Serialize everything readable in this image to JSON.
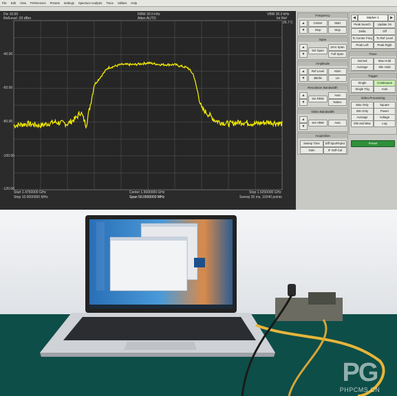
{
  "menu": [
    "File",
    "Edit",
    "View",
    "Preferences",
    "Presets",
    "Settings",
    "Spectrum Analysis",
    "Trace",
    "Utilities",
    "Help"
  ],
  "screen": {
    "div": "Div 10.00",
    "ref_level": "RefLevel -20 dBm",
    "rbw": "RBW 30.0 kHz",
    "atten": "Atten AUTO",
    "vbw": "VBW 30.0 kHz",
    "int_ref": "Int Ref",
    "temp": "25.7 C",
    "y_labels": [
      "-40.00",
      "-60.00",
      "-80.00",
      "-100.00",
      "-120.00"
    ],
    "start": "Start 1.4750000 GHz",
    "step": "Step 10.0000000 MHz",
    "center": "Center 1.5000000 GHz",
    "span": "Span 50.0000000 MHz",
    "stop": "Stop 1.5250000 GHz",
    "sweep": "Sweep 35 ms, 10240 points"
  },
  "chart_data": {
    "type": "line",
    "xlabel": "",
    "ylabel": "",
    "xlim_ghz": [
      1.475,
      1.525
    ],
    "ylim_dbm": [
      -120,
      -20
    ],
    "grid": true,
    "series": [
      {
        "color": "#f2ea00",
        "x_ghz": [
          1.475,
          1.4775,
          1.48,
          1.4825,
          1.485,
          1.4865,
          1.4875,
          1.4885,
          1.49,
          1.4925,
          1.495,
          1.4975,
          1.5,
          1.5025,
          1.505,
          1.5075,
          1.5085,
          1.51,
          1.5115,
          1.5125,
          1.5135,
          1.515,
          1.5175,
          1.52,
          1.5225,
          1.525
        ],
        "y_dbm": [
          -82,
          -81,
          -82,
          -80,
          -81,
          -78,
          -74,
          -82,
          -58,
          -48,
          -46,
          -46,
          -45,
          -46,
          -46,
          -48,
          -52,
          -72,
          -76,
          -79,
          -80,
          -81,
          -80,
          -81,
          -80,
          -81
        ]
      }
    ]
  },
  "panel": {
    "frequency": {
      "title": "Frequency",
      "center": "Center",
      "start": "Start",
      "step": "Step",
      "stop": "Stop"
    },
    "span": {
      "title": "Span",
      "zero_span": "Zero Span",
      "set_span": "Set Span",
      "full_span": "Full Span"
    },
    "amplitude": {
      "title": "Amplitude",
      "ref_level": "Ref Level",
      "atten": "Atten",
      "db_div": "dB/div",
      "lin": "Lin"
    },
    "rbw": {
      "title": "Resolution Bandwidth",
      "set_rbw": "Set RBW",
      "auto": "Auto",
      "native": "Native"
    },
    "vbw": {
      "title": "Video Bandwidth",
      "set_vbw": "Set VBW",
      "auto": "Auto"
    },
    "acq": {
      "title": "Acquisition",
      "sweep_time": "Sweep Time",
      "diff_spur": "Diff SpurReject",
      "gain": "Gain",
      "if_selfcal": "IF Self-Cal"
    },
    "marker": {
      "select": "Marker 1",
      "peak_search": "Peak Search",
      "update_on": "Update On",
      "delta": "Delta",
      "off": "Off",
      "to_center": "To Center Freq",
      "to_ref": "To Ref Level",
      "peak_left": "Peak Left",
      "peak_right": "Peak Right"
    },
    "trace": {
      "title": "Trace",
      "normal": "Normal",
      "max_hold": "Max Hold",
      "average": "Average",
      "min_hold": "Min Hold"
    },
    "trigger": {
      "title": "Trigger",
      "single": "Single",
      "continuous": "Continuous",
      "single_trig": "Single Trig",
      "auto": "Auto"
    },
    "video": {
      "title": "Video Processing",
      "max_only": "Max Only",
      "square": "Square",
      "min_only": "Min Only",
      "power": "Power",
      "average": "Average",
      "voltage": "Voltage",
      "min_and_max": "Min and Max",
      "log": "Log"
    },
    "preset": "Preset"
  },
  "watermark": {
    "letters": "PG",
    "text": "PHPCMS.CN"
  }
}
